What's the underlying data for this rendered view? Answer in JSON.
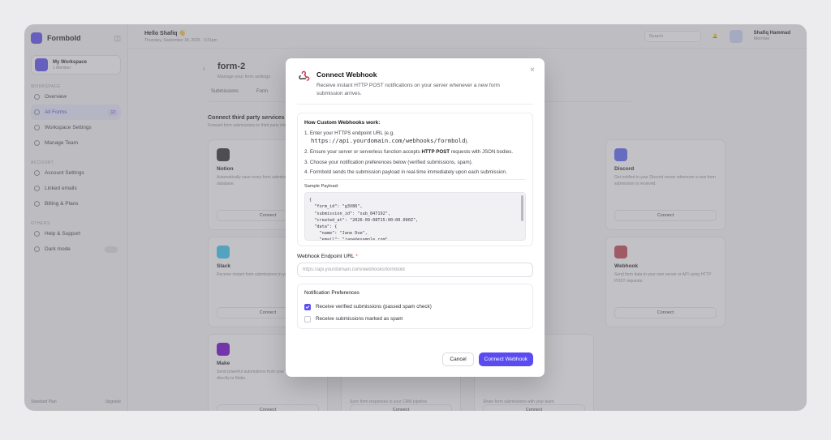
{
  "app": {
    "brand": "Formbold",
    "workspace": {
      "name": "My Workspace",
      "sub": "1 Member"
    },
    "sidebar_sections": [
      "WORKSPACE",
      "ACCOUNT",
      "OTHERS"
    ],
    "sidebar_items_ws": [
      {
        "label": "Overview"
      },
      {
        "label": "All Forms",
        "count": "12"
      },
      {
        "label": "Workspace Settings"
      },
      {
        "label": "Manage Team"
      }
    ],
    "sidebar_items_acct": [
      {
        "label": "Account Settings"
      },
      {
        "label": "Linked emails"
      },
      {
        "label": "Billing & Plans"
      }
    ],
    "sidebar_items_other": [
      {
        "label": "Help & Support"
      },
      {
        "label": "Dark mode"
      }
    ],
    "footer_left": "Standard Plan",
    "footer_right": "Upgrade",
    "greeting": "Hello Shafiq 👋",
    "date": "Thursday, September 18, 2025 · 3:31pm",
    "search_placeholder": "Search",
    "user_name": "Shafiq Hammad",
    "user_role": "Member",
    "page_title": "form-2",
    "page_sub": "Manage your form settings",
    "tabs": [
      "Submissions",
      "Form"
    ],
    "section_title": "Connect third party services",
    "section_sub": "Forward form submissions to third party integrations",
    "cards": [
      {
        "name": "Notion",
        "desc": "Automatically save every form submission to your Notion database.",
        "btn": "Connect",
        "color": "#2a2a2e"
      },
      {
        "name": "Discord",
        "desc": "Get notified in your Discord server whenever a new form submission is received.",
        "btn": "Connect",
        "color": "#5865f2"
      },
      {
        "name": "Slack",
        "desc": "Receive instant form submissions in your Slack channel.",
        "btn": "Connect",
        "color": "#36c5f0"
      },
      {
        "name": "Webhook",
        "desc": "Send form data to your own server or API using HTTP POST requests.",
        "btn": "Connect",
        "color": "#c1434f"
      },
      {
        "name": "Make",
        "desc": "Send powerful automations from your form submissions directly to Make.",
        "btn": "Connect",
        "color": "#6d00cc"
      },
      {
        "name": "",
        "desc": "Sync form responses to your CRM pipeline.",
        "btn": "Connect",
        "color": "#dddde2"
      },
      {
        "name": "",
        "desc": "Share form submissions with your team.",
        "btn": "Connect",
        "color": "#dddde2"
      }
    ]
  },
  "modal": {
    "title": "Connect Webhook",
    "description": "Receive instant HTTP POST notifications on your server whenever a new form submission arrives.",
    "close": "×",
    "how_title": "How Custom Webhooks work:",
    "step1_pre": "1. Enter your HTTPS endpoint URL (e.g.",
    "step1_code": "https://api.yourdomain.com/webhooks/formbold",
    "step1_post": ").",
    "step2_pre": "2. Ensure your server or serverless function accepts ",
    "step2_bold": "HTTP POST",
    "step2_post": " requests with JSON bodies.",
    "step3": "3. Choose your notification preferences below (verified submissions, spam).",
    "step4": "4. Formbold sends the submission payload in real-time immediately upon each submission.",
    "payload_label": "Sample Payload:",
    "payload": "{\n  \"form_id\": \"g3V86\",\n  \"submission_id\": \"sub_847192\",\n  \"created_at\": \"2026-09-08T15:00:00.000Z\",\n  \"data\": {\n    \"name\": \"Jane Doe\",\n    \"email\": \"jane@example.com\"",
    "field_label": "Webhook Endpoint URL",
    "required_mark": "*",
    "field_placeholder": "https://api.yourdomain.com/webhooks/formbold",
    "field_value": "",
    "prefs_title": "Notification Preferences",
    "pref_verified": "Receive verified submissions (passed spam check)",
    "pref_verified_checked": true,
    "pref_spam": "Receive submissions marked as spam",
    "pref_spam_checked": false,
    "cancel_label": "Cancel",
    "submit_label": "Connect Webhook"
  },
  "colors": {
    "accent": "#5a4cf0",
    "overlay": "rgba(120,120,128,0.45)",
    "required": "#e0414b"
  }
}
